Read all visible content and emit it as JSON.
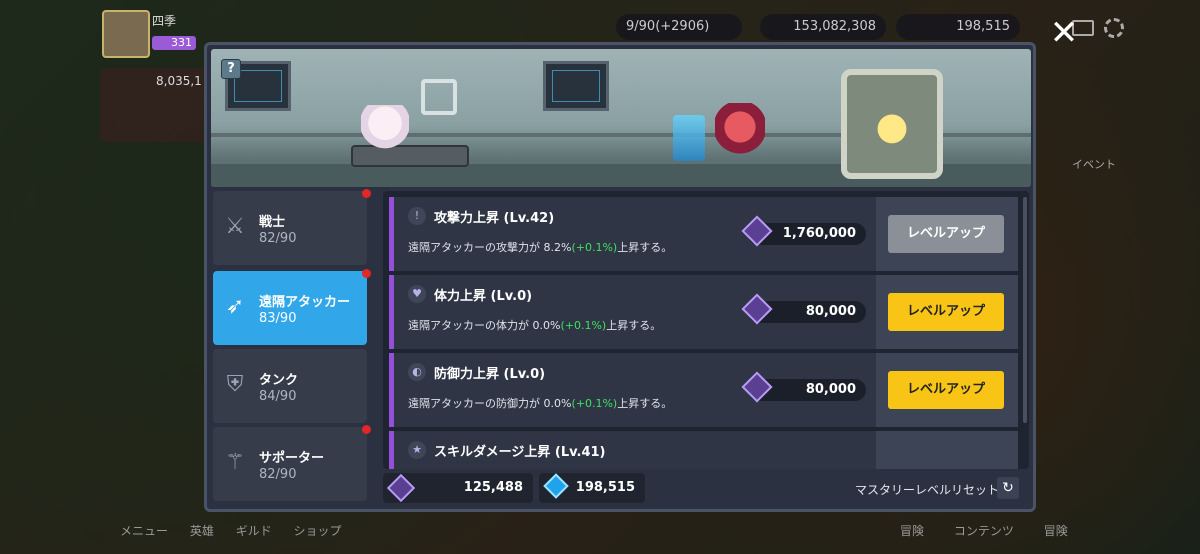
{
  "hud": {
    "player_name": "四季",
    "player_level": "331",
    "stamina": "9/90(+2906)",
    "gold": "153,082,308",
    "gems": "198,515",
    "power": "8,035,1",
    "event_label": "イベント"
  },
  "bottom_nav": [
    "メニュー",
    "英雄",
    "ギルド",
    "ショップ"
  ],
  "bottom_nav_right": [
    "冒険",
    "コンテンツ",
    "冒険"
  ],
  "modal": {
    "help": "?",
    "close": "✕",
    "categories": [
      {
        "name": "戦士",
        "count": "82/90",
        "icon": "sword-icon",
        "active": false,
        "dot": true
      },
      {
        "name": "遠隔アタッカー",
        "count": "83/90",
        "icon": "bow-icon",
        "active": true,
        "dot": true
      },
      {
        "name": "タンク",
        "count": "84/90",
        "icon": "shield-icon",
        "active": false,
        "dot": false
      },
      {
        "name": "サポーター",
        "count": "82/90",
        "icon": "staff-icon",
        "active": false,
        "dot": true
      }
    ],
    "upgrades": [
      {
        "title": "攻撃力上昇 (Lv.42)",
        "desc_pre": "遠隔アタッカーの攻撃力が 8.2%",
        "desc_up": "(+0.1%)",
        "desc_post": "上昇する。",
        "cost": "1,760,000",
        "button": "レベルアップ",
        "enabled": false,
        "icon": "attack-icon"
      },
      {
        "title": "体力上昇 (Lv.0)",
        "desc_pre": "遠隔アタッカーの体力が 0.0%",
        "desc_up": "(+0.1%)",
        "desc_post": "上昇する。",
        "cost": "80,000",
        "button": "レベルアップ",
        "enabled": true,
        "icon": "heart-icon"
      },
      {
        "title": "防御力上昇 (Lv.0)",
        "desc_pre": "遠隔アタッカーの防御力が 0.0%",
        "desc_up": "(+0.1%)",
        "desc_post": "上昇する。",
        "cost": "80,000",
        "button": "レベルアップ",
        "enabled": true,
        "icon": "defense-icon"
      },
      {
        "title": "スキルダメージ上昇 (Lv.41)",
        "icon": "star-icon"
      }
    ],
    "footer": {
      "mastery_points": "125,488",
      "gems": "198,515",
      "reset_label": "マスタリーレベルリセット"
    }
  },
  "colors": {
    "active_tab": "#31a7ea",
    "button_yellow": "#f8c516",
    "button_gray": "#8b8f98",
    "accent_purple": "#9450d8",
    "increase_green": "#3ee05f"
  }
}
